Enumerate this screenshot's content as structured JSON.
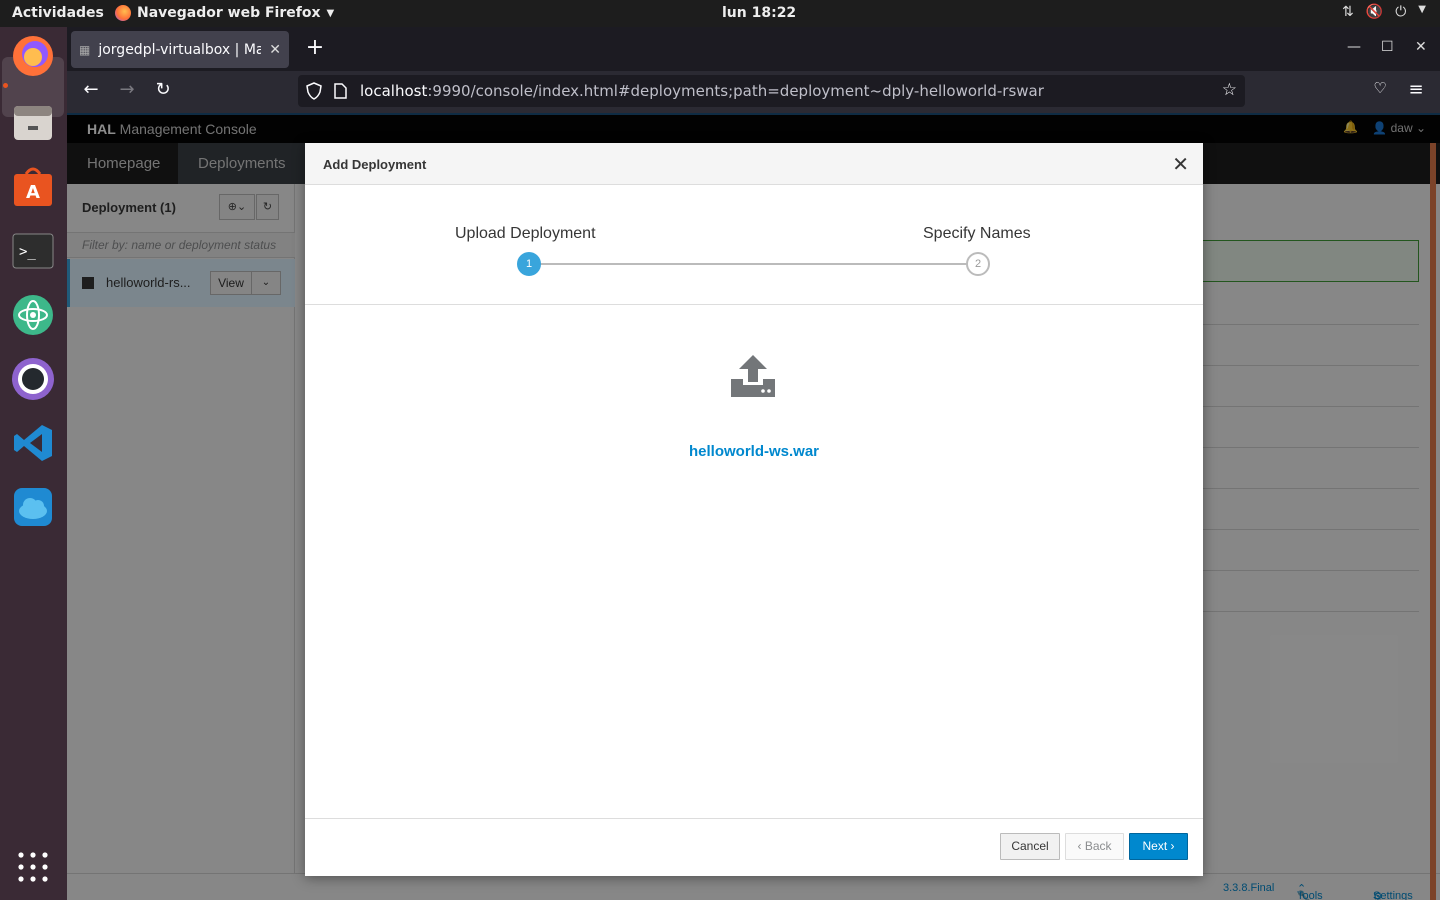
{
  "desktop": {
    "activities_label": "Actividades",
    "app_menu_label": "Navegador web Firefox",
    "clock": "lun 18:22"
  },
  "dock": {
    "items": [
      "firefox-icon",
      "files-icon",
      "software-center-icon",
      "terminal-icon",
      "atom-icon",
      "github-desktop-icon",
      "vscode-icon",
      "cloud-icon"
    ],
    "show_apps_icon": "grid-icon"
  },
  "browser": {
    "tab_title": "jorgedpl-virtualbox | Management Console",
    "url_host": "localhost",
    "url_rest": ":9990/console/index.html#deployments;path=deployment~dply-helloworld-rswar",
    "accent": "#0088ce"
  },
  "hal": {
    "brand_bold": "HAL",
    "brand_rest": " Management Console",
    "user_label": "daw",
    "nav_tabs": [
      "Homepage",
      "Deployments"
    ],
    "deployment_title": "Deployment (1)",
    "filter_placeholder": "Filter by: name or deployment status",
    "deployment_item": "helloworld-rs...",
    "view_label": "View",
    "footer": {
      "version": "3.3.8.Final",
      "tools_label": "Tools",
      "settings_label": "Settings"
    }
  },
  "modal": {
    "title": "Add Deployment",
    "steps": [
      {
        "label": "Upload Deployment",
        "number": "1",
        "active": true
      },
      {
        "label": "Specify Names",
        "number": "2",
        "active": false
      }
    ],
    "filename": "helloworld-ws.war",
    "buttons": {
      "cancel": "Cancel",
      "back": "Back",
      "next": "Next"
    }
  }
}
